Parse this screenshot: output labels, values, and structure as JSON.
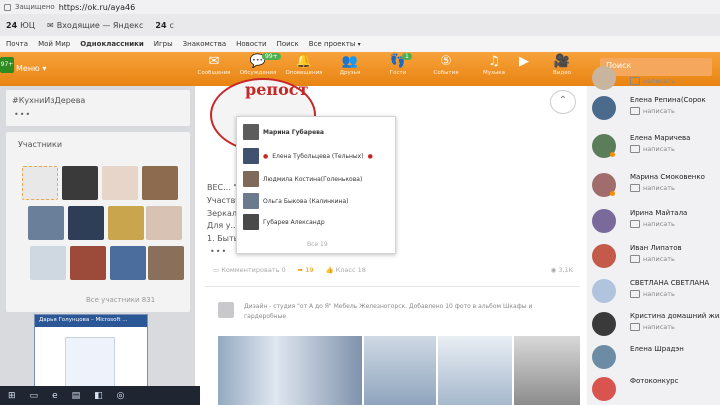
{
  "browser": {
    "secure_label": "Защищено",
    "url": "https://ok.ru/aya46"
  },
  "bookmarks": [
    {
      "badge": "24",
      "label": "ЮЦ"
    },
    {
      "label": "Входящие — Яндекс"
    },
    {
      "badge": "24",
      "label": "с"
    }
  ],
  "topnav": [
    "Почта",
    "Мой Мир",
    "Одноклассники",
    "Игры",
    "Знакомства",
    "Новости",
    "Поиск",
    "Все проекты"
  ],
  "topnav_active": "Одноклассники",
  "toolbar": {
    "logo_badge": "97+",
    "menu_label": "Меню",
    "items": [
      {
        "icon": "messages-icon",
        "glyph": "✉",
        "label": "Сообщения"
      },
      {
        "icon": "discussions-icon",
        "glyph": "💬",
        "label": "Обсуждения",
        "count": "99+"
      },
      {
        "icon": "alerts-icon",
        "glyph": "🔔",
        "label": "Оповещения"
      },
      {
        "icon": "friends-icon",
        "glyph": "👥",
        "label": "Друзья"
      },
      {
        "icon": "guests-icon",
        "glyph": "👣",
        "label": "Гости",
        "count": "1"
      },
      {
        "icon": "events-icon",
        "glyph": "⑤",
        "label": "События"
      },
      {
        "icon": "music-icon",
        "glyph": "♫",
        "label": "Музыка"
      },
      {
        "icon": "play-icon",
        "glyph": "▶",
        "label": ""
      },
      {
        "icon": "video-icon",
        "glyph": "🎥",
        "label": "Видео"
      }
    ],
    "search_placeholder": "Поиск"
  },
  "left": {
    "hashtag": "#КухниИзДерева",
    "dots": "•••",
    "members_title": "Участники",
    "all_members": "Все участники 831",
    "word_window_title": "Дарья Голунцова – Microsoft ...",
    "thumb_colors": [
      "#f0a64a",
      "#3a3a3a",
      "#e8d5c9",
      "#8c6b4e",
      "#6a7f99",
      "#2d3e56",
      "#c9a54e",
      "#d8c2b3",
      "#cfd7e0",
      "#9c4b3b",
      "#4a6d9e",
      "#8a6f5a",
      "#b9c7d6"
    ]
  },
  "feed": {
    "repost_word": "репост",
    "post_lines": [
      "ВЕС... \"От А до Я\" Мебель!!✨",
      "Участву...",
      "Зеркал...",
      "Для у...",
      "1. Быть... группу: Дизайн-студия \"от А до Я\""
    ],
    "dots": "•••",
    "actions": {
      "comments_label": "Комментировать",
      "comments_count": "0",
      "likes_count": "19",
      "share_label": "Класс",
      "share_count": "18",
      "views": "3,1K"
    },
    "post2_text": "Дизайн - студия \"от А до Я\" Мебель Железногорск. Добавлено 10 фото в альбом Шкафы и гардеробные"
  },
  "popup": {
    "rows": [
      {
        "name": "Марина Губарева",
        "bold": true,
        "heart": false,
        "color": "#5c5c5c"
      },
      {
        "name": "Елена Тубольцева (Тельных)",
        "bold": false,
        "heart": true,
        "color": "#3f5370"
      },
      {
        "name": "Людмила Костина(Голенькова)",
        "bold": false,
        "heart": false,
        "color": "#7d6a5a"
      },
      {
        "name": "Ольга Быкова (Калинкина)",
        "bold": false,
        "heart": false,
        "color": "#6b7a8c"
      },
      {
        "name": "Губарев Александр",
        "bold": false,
        "heart": false,
        "color": "#4a4a4a"
      }
    ],
    "all_label": "Все 19"
  },
  "friends": [
    {
      "name": "",
      "action": "написать",
      "color": "#c9b59e"
    },
    {
      "name": "Елена Репина(Сорок",
      "action": "написать",
      "color": "#4a6b8c"
    },
    {
      "name": "Елена Маричева",
      "action": "написать",
      "color": "#5c7d5a"
    },
    {
      "name": "Марина Смоковенко",
      "action": "написать",
      "color": "#a06c6c"
    },
    {
      "name": "Ирина Майтала",
      "action": "написать",
      "color": "#7a6a9c"
    },
    {
      "name": "Иван Липатов",
      "action": "написать",
      "color": "#c45a4a"
    },
    {
      "name": "СВЕТЛАНА СВЕТЛАНА",
      "action": "написать",
      "color": "#b0c4de"
    },
    {
      "name": "Кристина домашний жил",
      "action": "написать",
      "color": "#3a3a3a"
    },
    {
      "name": "Елена Шрадэн",
      "action": "",
      "color": "#6c8ca6"
    },
    {
      "name": "Фотоконкурс",
      "action": "",
      "color": "#d9534f"
    }
  ]
}
